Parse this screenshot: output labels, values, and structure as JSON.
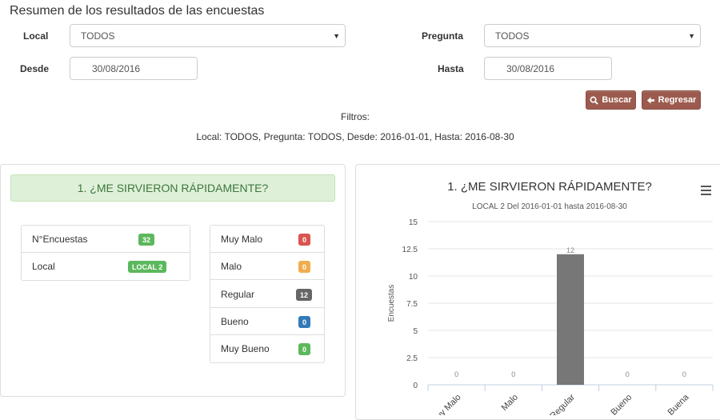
{
  "page": {
    "title": "Resumen de los resultados de las encuestas"
  },
  "filters": {
    "local_label": "Local",
    "local_value": "TODOS",
    "pregunta_label": "Pregunta",
    "pregunta_value": "TODOS",
    "desde_label": "Desde",
    "desde_value": "30/08/2016",
    "hasta_label": "Hasta",
    "hasta_value": "30/08/2016"
  },
  "buttons": {
    "buscar": "Buscar",
    "regresar": "Regresar"
  },
  "filtros": {
    "label": "Filtros:",
    "summary": "Local: TODOS, Pregunta: TODOS, Desde: 2016-01-01, Hasta: 2016-08-30"
  },
  "question": {
    "title": "1. ¿ME SIRVIERON RÁPIDAMENTE?",
    "info": [
      {
        "label": "N°Encuestas",
        "value": "32",
        "color": "#5cb85c"
      },
      {
        "label": "Local",
        "value": "LOCAL 2",
        "color": "#5cb85c"
      }
    ],
    "answers": [
      {
        "label": "Muy Malo",
        "value": "0",
        "color": "#d9534f"
      },
      {
        "label": "Malo",
        "value": "0",
        "color": "#f0ad4e"
      },
      {
        "label": "Regular",
        "value": "12",
        "color": "#666666"
      },
      {
        "label": "Bueno",
        "value": "0",
        "color": "#337ab7"
      },
      {
        "label": "Muy Bueno",
        "value": "0",
        "color": "#5cb85c"
      }
    ]
  },
  "chart_data": {
    "type": "bar",
    "title": "1. ¿ME SIRVIERON RÁPIDAMENTE?",
    "subtitle": "LOCAL 2 Del 2016-01-01 hasta 2016-08-30",
    "ylabel": "Encuestas",
    "xlabel": "",
    "categories": [
      "Muy Malo",
      "Malo",
      "Regular",
      "Bueno",
      "Buena"
    ],
    "values": [
      0,
      0,
      12,
      0,
      0
    ],
    "ylim": [
      0,
      15
    ],
    "yticks": [
      "0",
      "2.5",
      "5",
      "7.5",
      "10",
      "12.5",
      "15"
    ],
    "bar_color": "#777777",
    "grid": true,
    "legend": "none"
  }
}
